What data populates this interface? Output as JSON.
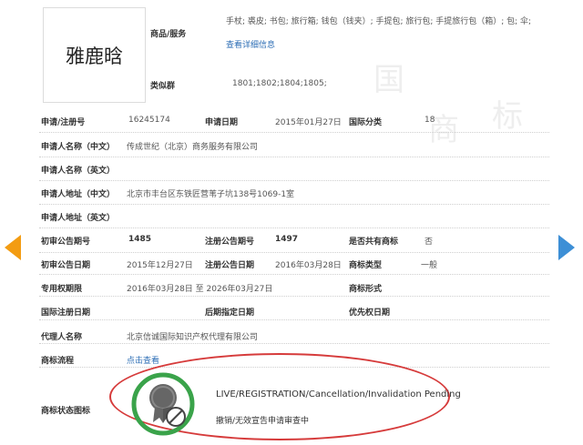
{
  "logo_text": "雅鹿晗",
  "goods": {
    "label": "商品/服务",
    "value": "手杖; 裘皮; 书包; 旅行箱; 钱包（钱夹）; 手提包; 旅行包; 手提旅行包（箱）; 包; 伞;",
    "detail_link": "查看详细信息"
  },
  "similar_group": {
    "label": "类似群",
    "value": "1801;1802;1804;1805;"
  },
  "rows": {
    "reg_no_label": "申请/注册号",
    "reg_no": "16245174",
    "app_date_label": "申请日期",
    "app_date": "2015年01月27日",
    "intl_class_label": "国际分类",
    "intl_class": "18",
    "applicant_cn_label": "申请人名称（中文）",
    "applicant_cn": "传成世纪（北京）商务服务有限公司",
    "applicant_en_label": "申请人名称（英文）",
    "address_cn_label": "申请人地址（中文）",
    "address_cn": "北京市丰台区东铁匠营苇子坑138号1069-1室",
    "address_en_label": "申请人地址（英文）",
    "prelim_pub_no_label": "初审公告期号",
    "prelim_pub_no": "1485",
    "reg_pub_no_label": "注册公告期号",
    "reg_pub_no": "1497",
    "shared_label": "是否共有商标",
    "shared": "否",
    "prelim_pub_date_label": "初审公告日期",
    "prelim_pub_date": "2015年12月27日",
    "reg_pub_date_label": "注册公告日期",
    "reg_pub_date": "2016年03月28日",
    "tm_type_label": "商标类型",
    "tm_type": "一般",
    "exclusive_label": "专用权期限",
    "exclusive": "2016年03月28日 至 2026年03月27日",
    "tm_form_label": "商标形式",
    "intl_reg_date_label": "国际注册日期",
    "later_date_label": "后期指定日期",
    "priority_date_label": "优先权日期",
    "agent_label": "代理人名称",
    "agent": "北京信诚国际知识产权代理有限公司",
    "process_label": "商标流程",
    "process_link": "点击查看",
    "status_label": "商标状态图标"
  },
  "status": {
    "en": "LIVE/REGISTRATION/Cancellation/Invalidation Pending",
    "cn": "撤销/无效宣告申请审查中"
  },
  "watermark": "中 国 商 标",
  "colors": {
    "link": "#2d6eb5",
    "ellipse": "#d63b3b",
    "ring": "#3aa34a",
    "left_arrow": "#f39c12",
    "right_arrow": "#3d8fd6"
  }
}
